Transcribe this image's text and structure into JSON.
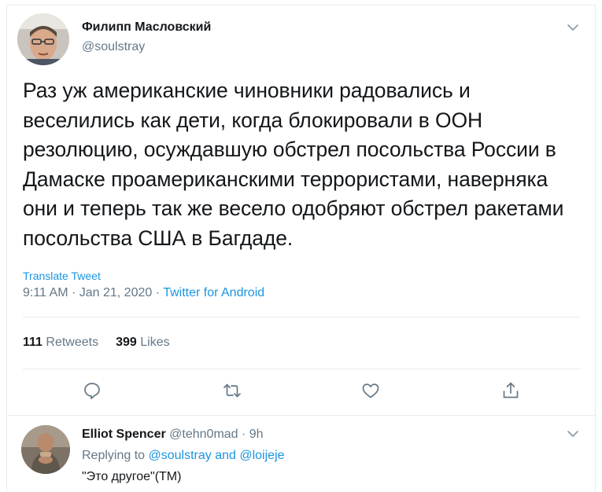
{
  "tweet": {
    "author_name": "Филипп Масловский",
    "author_handle": "@soulstray",
    "text": "Раз уж американские чиновники радовались и веселились как дети, когда блокировали в ООН резолюцию, осуждавшую обстрел посольства России в Дамаске проамериканскими террористами, наверняка они и теперь так же весело одобряют обстрел ракетами посольства США в Багдаде.",
    "translate_label": "Translate Tweet",
    "time": "9:11 AM",
    "date": "Jan 21, 2020",
    "separator": " · ",
    "source": "Twitter for Android",
    "retweets_count": "111",
    "retweets_label": "Retweets",
    "likes_count": "399",
    "likes_label": "Likes"
  },
  "actions": [
    "reply-icon",
    "retweet-icon",
    "like-icon",
    "share-icon"
  ],
  "reply": {
    "author_name": "Elliot Spencer",
    "author_handle": "@tehn0mad",
    "age": "9h",
    "separator": " · ",
    "replying_prefix": "Replying to ",
    "mention_1": "@soulstray",
    "mention_joiner": " and ",
    "mention_2": "@loijeje",
    "text": "\"Это другое\"(TM)"
  },
  "colors": {
    "link": "#1b95e0",
    "secondary": "#657786",
    "text": "#14171a",
    "border": "#e6ecf0"
  }
}
